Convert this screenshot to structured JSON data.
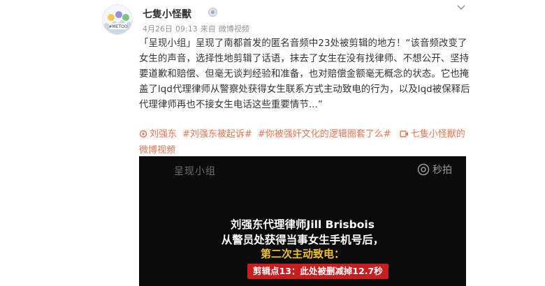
{
  "post": {
    "author": "七隻小怪獸",
    "avatar_text": "#METOO",
    "date": "4月26日",
    "time": "09:13",
    "source_prefix": "来自",
    "source": "微博视频",
    "content": "「呈现小组」呈现了南都首发的匿名音频中23处被剪辑的地方！“该音频改变了女生的声音，选择性地剪辑了话语，抹去了女生在没有找律师、不想公开、坚持要道歉和赔偿、但毫无谈判经验和准备，也对赔偿金额毫无概念的状态。它也掩盖了lqd代理律师从警察处获得女生联系方式主动致电的行为，以及lqd被保释后代理律师再也不接女生电话这些重要情节...”",
    "tags": {
      "location": "刘强东",
      "tag1": "#刘强东被起诉#",
      "tag2": "#你被强奸文化的逻辑圈套了么#",
      "video_link": "七隻小怪獸的微博视频"
    },
    "icons": {
      "more": "chevron-down-icon",
      "badge": "verified-badge-icon",
      "location": "location-icon",
      "video": "video-icon",
      "camera": "camera-icon"
    },
    "colors": {
      "link": "#eb7350",
      "video_bg": "#0b0b0b",
      "highlight": "#f3c21b",
      "badge_bg": "#c81e1e"
    }
  },
  "video": {
    "watermark_left": "呈现小组",
    "watermark_right": "秒拍",
    "line1": "刘强东代理律师Jill Brisbois",
    "line2": "从警员处获得当事女生手机号后，",
    "line3": "第二次主动致电：",
    "badge": "剪辑点13：此处被删减掉12.7秒"
  }
}
